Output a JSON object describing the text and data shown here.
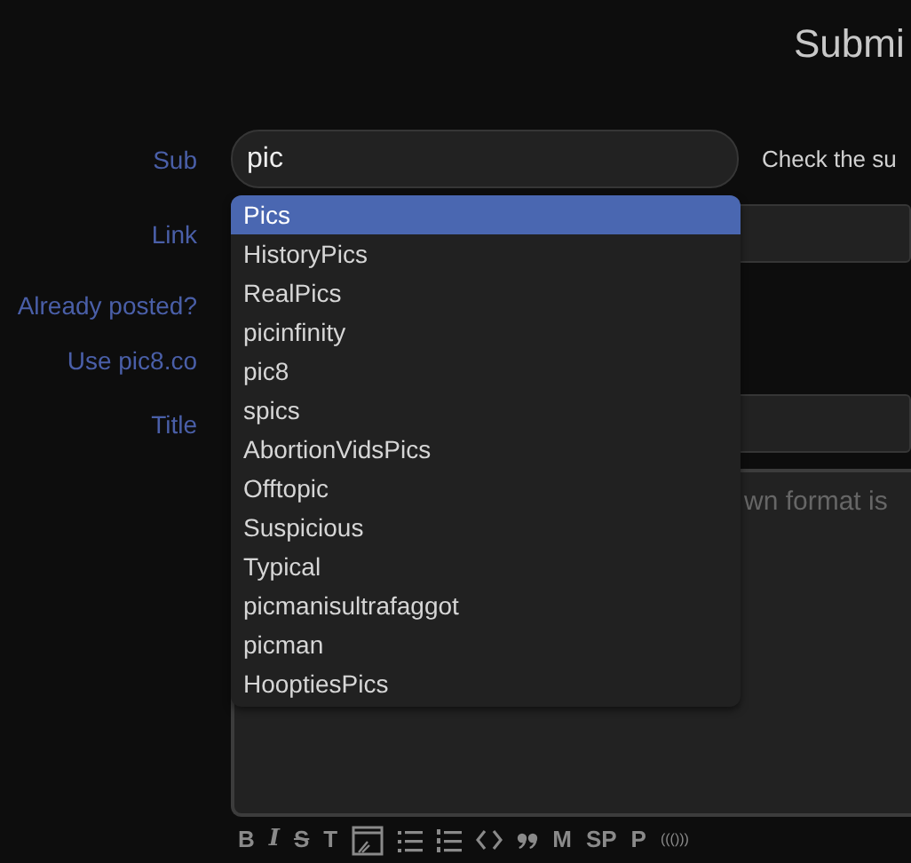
{
  "page": {
    "title": "Submi"
  },
  "fields": [
    {
      "kind": "input",
      "label": "Sub",
      "value": "pic",
      "note": "Check the su"
    },
    {
      "kind": "input",
      "label": "Link"
    },
    {
      "kind": "link",
      "label": "Already posted?"
    },
    {
      "kind": "link",
      "label": "Use pic8.co"
    },
    {
      "kind": "input",
      "label": "Title"
    },
    {
      "kind": "textarea",
      "placeholder": "wn format is"
    }
  ],
  "suggestions": [
    {
      "label": "Pics",
      "selected": true
    },
    {
      "label": "HistoryPics",
      "selected": false
    },
    {
      "label": "RealPics",
      "selected": false
    },
    {
      "label": "picinfinity",
      "selected": false
    },
    {
      "label": "pic8",
      "selected": false
    },
    {
      "label": "spics",
      "selected": false
    },
    {
      "label": "AbortionVidsPics",
      "selected": false
    },
    {
      "label": "Offtopic",
      "selected": false
    },
    {
      "label": "Suspicious",
      "selected": false
    },
    {
      "label": "Typical",
      "selected": false
    },
    {
      "label": "picmanisultrafaggot",
      "selected": false
    },
    {
      "label": "picman",
      "selected": false
    },
    {
      "label": "HooptiesPics",
      "selected": false
    }
  ],
  "toolbar": [
    {
      "kind": "text",
      "label": "B"
    },
    {
      "kind": "text",
      "label": "I"
    },
    {
      "kind": "text",
      "label": "S"
    },
    {
      "kind": "text",
      "label": "T"
    },
    {
      "kind": "icon"
    },
    {
      "kind": "icon"
    },
    {
      "kind": "icon"
    },
    {
      "kind": "icon"
    },
    {
      "kind": "icon"
    },
    {
      "kind": "text",
      "label": "M"
    },
    {
      "kind": "text",
      "label": "SP"
    },
    {
      "kind": "text",
      "label": "P"
    },
    {
      "kind": "text",
      "label": "((()))"
    }
  ]
}
